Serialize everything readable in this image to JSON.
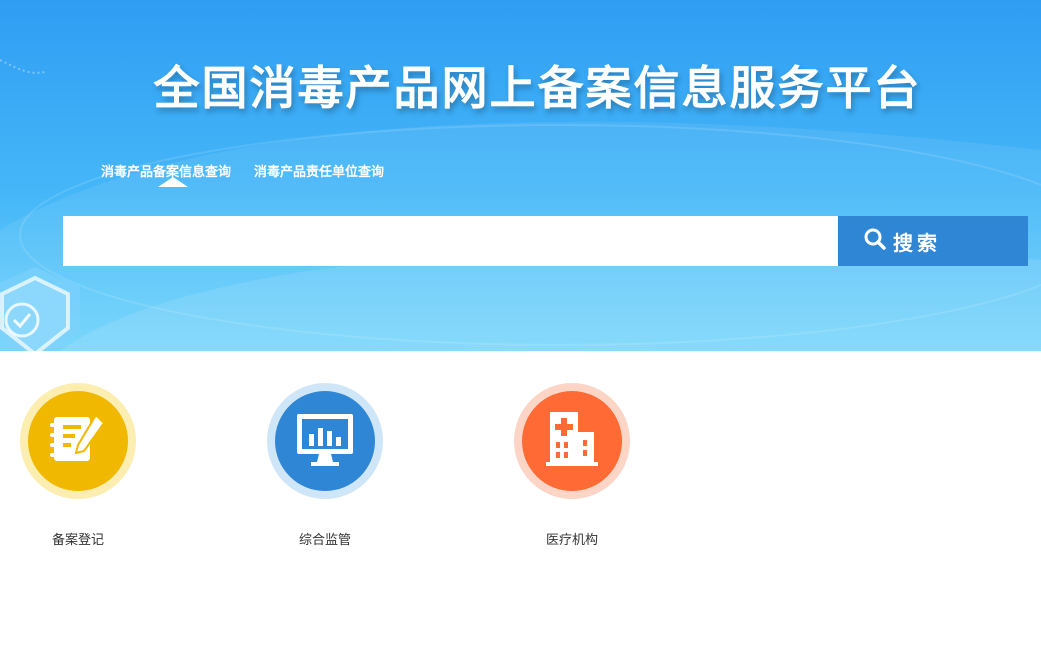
{
  "page": {
    "title": "全国消毒产品网上备案信息服务平台"
  },
  "search": {
    "tabs": [
      {
        "label": "消毒产品备案信息查询",
        "active": true
      },
      {
        "label": "消毒产品责任单位查询",
        "active": false
      }
    ],
    "input_value": "",
    "button_label": "搜索",
    "button_icon": "search-icon"
  },
  "features": [
    {
      "label": "备案登记",
      "icon": "notepad-pen-icon",
      "color": "#f0b800",
      "ring_color": "#fbeeb0"
    },
    {
      "label": "综合监管",
      "icon": "monitor-chart-icon",
      "color": "#2f86d5",
      "ring_color": "#cfe6f8"
    },
    {
      "label": "医疗机构",
      "icon": "hospital-icon",
      "color": "#ff6a35",
      "ring_color": "#fdd5c6"
    }
  ],
  "colors": {
    "hero_top": "#2f9df3",
    "hero_bottom": "#6fd4fb",
    "search_button": "#2f86d5"
  }
}
